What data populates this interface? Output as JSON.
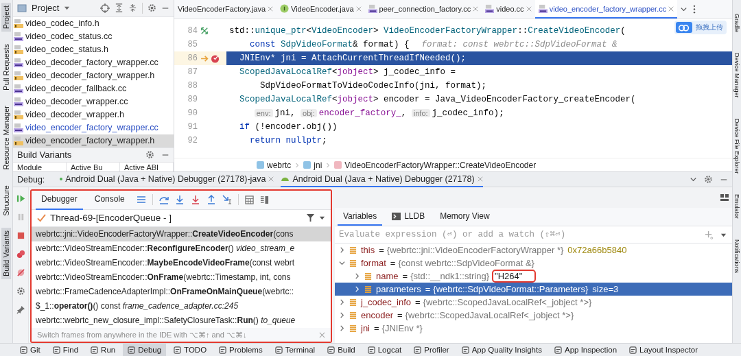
{
  "left_toolwindow_bar": {
    "items": [
      {
        "label": "Project",
        "selected": true
      },
      {
        "label": "Pull Requests",
        "selected": false
      },
      {
        "label": "Resource Manager",
        "selected": false
      },
      {
        "label": "Structure",
        "selected": false
      },
      {
        "label": "Build Variants",
        "selected": true
      }
    ]
  },
  "project_panel": {
    "title": "Project",
    "files": [
      {
        "name": "video_codec_info.h",
        "kind": "h",
        "changed": false,
        "selected": false
      },
      {
        "name": "video_codec_status.cc",
        "kind": "cpp",
        "changed": false,
        "selected": false
      },
      {
        "name": "video_codec_status.h",
        "kind": "h",
        "changed": false,
        "selected": false
      },
      {
        "name": "video_decoder_factory_wrapper.cc",
        "kind": "cpp",
        "changed": false,
        "selected": false
      },
      {
        "name": "video_decoder_factory_wrapper.h",
        "kind": "h",
        "changed": false,
        "selected": false
      },
      {
        "name": "video_decoder_fallback.cc",
        "kind": "cpp",
        "changed": false,
        "selected": false
      },
      {
        "name": "video_decoder_wrapper.cc",
        "kind": "cpp",
        "changed": false,
        "selected": false
      },
      {
        "name": "video_decoder_wrapper.h",
        "kind": "h",
        "changed": false,
        "selected": false
      },
      {
        "name": "video_encoder_factory_wrapper.cc",
        "kind": "cpp",
        "changed": true,
        "selected": false
      },
      {
        "name": "video_encoder_factory_wrapper.h",
        "kind": "h",
        "changed": false,
        "selected": true
      }
    ]
  },
  "build_variants": {
    "title": "Build Variants",
    "columns": [
      "Module",
      "Active Bu",
      "Active ABI"
    ]
  },
  "editor": {
    "tabs": [
      {
        "label": "VideoEncoderFactory.java",
        "kind": "plain",
        "selected": false
      },
      {
        "label": "VideoEncoder.java",
        "kind": "interface",
        "selected": false
      },
      {
        "label": "peer_connection_factory.cc",
        "kind": "cpp",
        "selected": false
      },
      {
        "label": "video.cc",
        "kind": "cpp",
        "selected": false
      },
      {
        "label": "video_encoder_factory_wrapper.cc",
        "kind": "cpp",
        "selected": true
      }
    ],
    "lines": [
      {
        "number": "84",
        "current": false,
        "kind": "implements",
        "tokens": [
          {
            "t": "std::",
            "kind": "plain"
          },
          {
            "t": "unique_ptr",
            "kind": "type"
          },
          {
            "t": "<",
            "kind": "plain"
          },
          {
            "t": "VideoEncoder",
            "kind": "type"
          },
          {
            "t": "> ",
            "kind": "plain"
          },
          {
            "t": "VideoEncoderFactoryWrapper",
            "kind": "type"
          },
          {
            "t": "::",
            "kind": "plain"
          },
          {
            "t": "CreateVideoEncoder",
            "kind": "fn"
          },
          {
            "t": "(",
            "kind": "plain"
          }
        ]
      },
      {
        "number": "85",
        "current": false,
        "kind": "plain",
        "tokens": [
          {
            "t": "    const",
            "kind": "kw"
          },
          {
            "t": " SdpVideoFormat",
            "kind": "type"
          },
          {
            "t": "& format) {",
            "kind": "plain"
          },
          {
            "t": "format: const webrtc::SdpVideoFormat &",
            "kind": "hint"
          }
        ]
      },
      {
        "number": "86",
        "current": true,
        "kind": "execution-breakpoint",
        "tokens": [
          {
            "t": "  JNIEnv* jni = AttachCurrentThreadIfNeeded();",
            "kind": "plain"
          }
        ]
      },
      {
        "number": "87",
        "current": false,
        "kind": "plain",
        "tokens": [
          {
            "t": "  ScopedJavaLocalRef",
            "kind": "type"
          },
          {
            "t": "<",
            "kind": "plain"
          },
          {
            "t": "jobject",
            "kind": "purple"
          },
          {
            "t": "> j_codec_info =",
            "kind": "plain"
          }
        ]
      },
      {
        "number": "88",
        "current": false,
        "kind": "plain",
        "tokens": [
          {
            "t": "      SdpVideoFormatToVideoCodecInfo(jni, format);",
            "kind": "plain"
          }
        ]
      },
      {
        "number": "89",
        "current": false,
        "kind": "plain",
        "tokens": [
          {
            "t": "  ScopedJavaLocalRef",
            "kind": "type"
          },
          {
            "t": "<",
            "kind": "plain"
          },
          {
            "t": "jobject",
            "kind": "purple"
          },
          {
            "t": "> encoder = Java_VideoEncoderFactory_createEncoder(",
            "kind": "plain"
          }
        ]
      },
      {
        "number": "90",
        "current": false,
        "kind": "plain",
        "tokens": [
          {
            "t": "env:",
            "kind": "param"
          },
          {
            "t": "jni, ",
            "kind": "plain"
          },
          {
            "t": "obj:",
            "kind": "param"
          },
          {
            "t": "encoder_factory_",
            "kind": "purple"
          },
          {
            "t": ", ",
            "kind": "plain"
          },
          {
            "t": "info:",
            "kind": "param"
          },
          {
            "t": "j_codec_info);",
            "kind": "plain"
          }
        ]
      },
      {
        "number": "91",
        "current": false,
        "kind": "plain",
        "tokens": [
          {
            "t": "  if",
            "kind": "kw"
          },
          {
            "t": " (!encoder.obj())",
            "kind": "plain"
          }
        ]
      },
      {
        "number": "92",
        "current": false,
        "kind": "plain",
        "tokens": [
          {
            "t": "    return",
            "kind": "kw"
          },
          {
            "t": " nullptr",
            "kind": "kw"
          },
          {
            "t": ";",
            "kind": "plain"
          }
        ]
      }
    ],
    "breadcrumb": [
      {
        "label": "webrtc",
        "kind": "namespace"
      },
      {
        "label": "jni",
        "kind": "namespace"
      },
      {
        "label": "VideoEncoderFactoryWrapper::CreateVideoEncoder",
        "kind": "function"
      }
    ]
  },
  "upload_widget": {
    "label": "拖拽上传"
  },
  "right_toolwindow_bar": {
    "items": [
      "Gradle",
      "Device Manager",
      "Device File Explorer",
      "Emulator",
      "Notifications"
    ]
  },
  "debug": {
    "label": "Debug:",
    "sessions": [
      {
        "label": "Android Dual (Java + Native) Debugger (27178)-java",
        "selected": false
      },
      {
        "label": "Android Dual (Java + Native) Debugger (27178)",
        "selected": true
      }
    ],
    "panel_tabs": [
      {
        "label": "Debugger",
        "selected": true
      },
      {
        "label": "Console",
        "selected": false
      }
    ],
    "thread": "Thread-69-[EncoderQueue - ]",
    "frames_annotated": true,
    "frames": [
      {
        "text": "webrtc::jni::VideoEncoderFactoryWrapper::**CreateVideoEncoder**(cons",
        "selected": true
      },
      {
        "text": "webrtc::VideoStreamEncoder::**ReconfigureEncoder**() *video_stream_e*",
        "selected": false
      },
      {
        "text": "webrtc::VideoStreamEncoder::**MaybeEncodeVideoFrame**(const webrt",
        "selected": false
      },
      {
        "text": "webrtc::VideoStreamEncoder::**OnFrame**(webrtc::Timestamp, int, cons",
        "selected": false
      },
      {
        "text": "webrtc::FrameCadenceAdapterImpl::**OnFrameOnMainQueue**(webrtc::",
        "selected": false
      },
      {
        "text": "$_1::**operator()**() const *frame_cadence_adapter.cc:245*",
        "selected": false
      },
      {
        "text": "webrtc::webrtc_new_closure_impl::SafetyClosureTask::**Run**() *to_queue*",
        "selected": false
      }
    ],
    "hint": "Switch frames from anywhere in the IDE with ⌥⌘↑ and ⌥⌘↓",
    "var_tabs": [
      {
        "label": "Variables",
        "selected": true
      },
      {
        "label": "LLDB",
        "selected": false
      },
      {
        "label": "Memory View",
        "selected": false
      }
    ],
    "evaluate": {
      "placeholder": "Evaluate expression (⏎) or add a watch (⇧⌘⏎)"
    },
    "variables": [
      {
        "name": "this",
        "eq": "=",
        "type": "{webrtc::jni::VideoEncoderFactoryWrapper *}",
        "value": "0x72a66b5840",
        "expanded": false,
        "selected": false
      },
      {
        "name": "format",
        "eq": "=",
        "type": "{const webrtc::SdpVideoFormat &}",
        "expanded": true,
        "selected": false,
        "children": [
          {
            "name": "name",
            "eq": "=",
            "type": "{std::__ndk1::string}",
            "value": "\"H264\"",
            "annotated": true,
            "expanded": false,
            "selected": false
          },
          {
            "name": "parameters",
            "eq": "=",
            "type": "{webrtc::SdpVideoFormat::Parameters}",
            "value": "size=3",
            "expanded": false,
            "selected": true
          }
        ]
      },
      {
        "name": "j_codec_info",
        "eq": "=",
        "type": "{webrtc::ScopedJavaLocalRef<_jobject *>}",
        "expanded": false,
        "selected": false
      },
      {
        "name": "encoder",
        "eq": "=",
        "type": "{webrtc::ScopedJavaLocalRef<_jobject *>}",
        "expanded": false,
        "selected": false
      },
      {
        "name": "jni",
        "eq": "=",
        "type": "{JNIEnv *}",
        "expanded": false,
        "selected": false
      }
    ]
  },
  "bottom_bar": {
    "items": [
      {
        "label": "Git",
        "selected": false
      },
      {
        "label": "Find",
        "selected": false
      },
      {
        "label": "Run",
        "selected": false
      },
      {
        "label": "Debug",
        "selected": true
      },
      {
        "label": "TODO",
        "selected": false
      },
      {
        "label": "Problems",
        "selected": false
      },
      {
        "label": "Terminal",
        "selected": false
      },
      {
        "label": "Build",
        "selected": false
      },
      {
        "label": "Logcat",
        "selected": false
      },
      {
        "label": "Profiler",
        "selected": false
      },
      {
        "label": "App Quality Insights",
        "selected": false
      },
      {
        "label": "App Inspection",
        "selected": false
      },
      {
        "label": "Layout Inspector",
        "selected": false
      }
    ]
  }
}
